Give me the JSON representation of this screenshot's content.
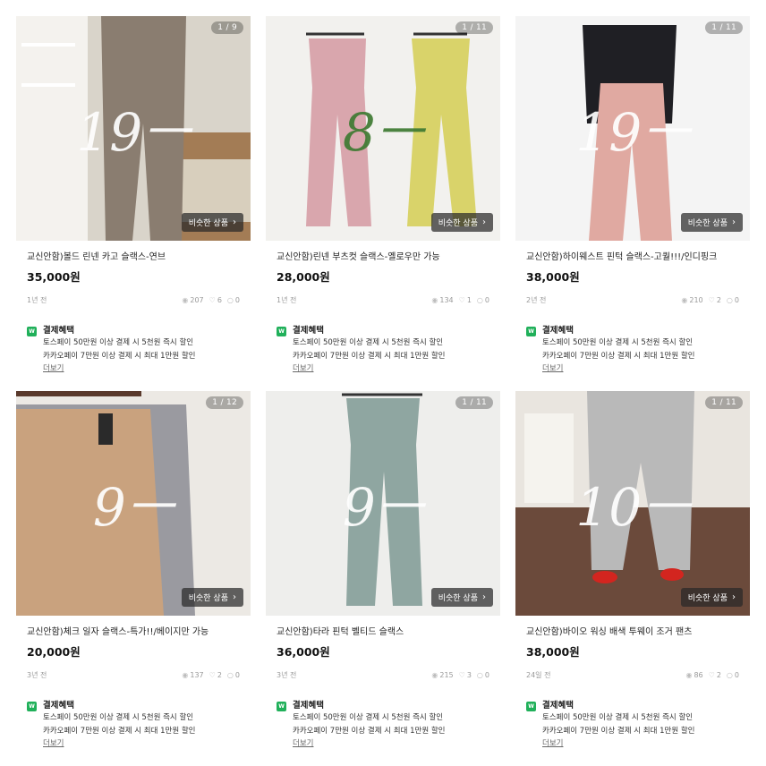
{
  "common": {
    "similar_label": "비슷한 상품",
    "benefit_title": "결제혜택",
    "benefit_lines": [
      "토스페이 50만원 이상 결제 시 5천원 즉시 할인",
      "카카오페이 7만원 이상 결제 시 최대 1만원 할인"
    ],
    "more_label": "더보기",
    "pay_badge": "W"
  },
  "products": [
    {
      "counter": "1 / 9",
      "title": "교신안함)볼드 린넨 카고 슬랙스-연브",
      "price": "35,000원",
      "age": "1년 전",
      "views": "207",
      "likes": "6",
      "chats": "0",
      "note": "19ㅡ",
      "colors": {
        "bg": "#d9d4ca",
        "item": "#8a7d70",
        "note": "#ffffff"
      }
    },
    {
      "counter": "1 / 11",
      "title": "교신안함)린넨 부츠컷 슬랙스-옐로우만 가능",
      "price": "28,000원",
      "age": "1년 전",
      "views": "134",
      "likes": "1",
      "chats": "0",
      "note": "8ㅡ",
      "colors": {
        "bg": "#f2f1ee",
        "item": "#d9a6ad",
        "item2": "#d9d36a",
        "note": "#3e7a32"
      }
    },
    {
      "counter": "1 / 11",
      "title": "교신안함)하이웨스트 핀턱 슬랙스-고퀄!!!/인디핑크",
      "price": "38,000원",
      "age": "2년 전",
      "views": "210",
      "likes": "2",
      "chats": "0",
      "note": "19ㅡ",
      "colors": {
        "bg": "#f4f4f4",
        "item": "#e0a9a1",
        "item2": "#1f1f24",
        "note": "#ffffff"
      }
    },
    {
      "counter": "1 / 12",
      "title": "교신안함)체크 일자 슬랙스-특가!!/베이지만 가능",
      "price": "20,000원",
      "age": "3년 전",
      "views": "137",
      "likes": "2",
      "chats": "0",
      "note": "9ㅡ",
      "colors": {
        "bg": "#ece9e4",
        "item": "#c9a27e",
        "item2": "#9a9aa0",
        "note": "#ffffff"
      }
    },
    {
      "counter": "1 / 11",
      "title": "교신안함)타라 핀턱 벨티드 슬랙스",
      "price": "36,000원",
      "age": "3년 전",
      "views": "215",
      "likes": "3",
      "chats": "0",
      "note": "9ㅡ",
      "colors": {
        "bg": "#eeeeec",
        "item": "#8fa6a1",
        "note": "#ffffff"
      }
    },
    {
      "counter": "1 / 11",
      "title": "교신안함)바이오 워싱 배색 투웨이 조거 팬츠",
      "price": "38,000원",
      "age": "24일 전",
      "views": "86",
      "likes": "2",
      "chats": "0",
      "note": "10ㅡ",
      "colors": {
        "bg": "#e9e5df",
        "item": "#b9b9b9",
        "item2": "#d3251f",
        "note": "#ffffff"
      }
    }
  ]
}
